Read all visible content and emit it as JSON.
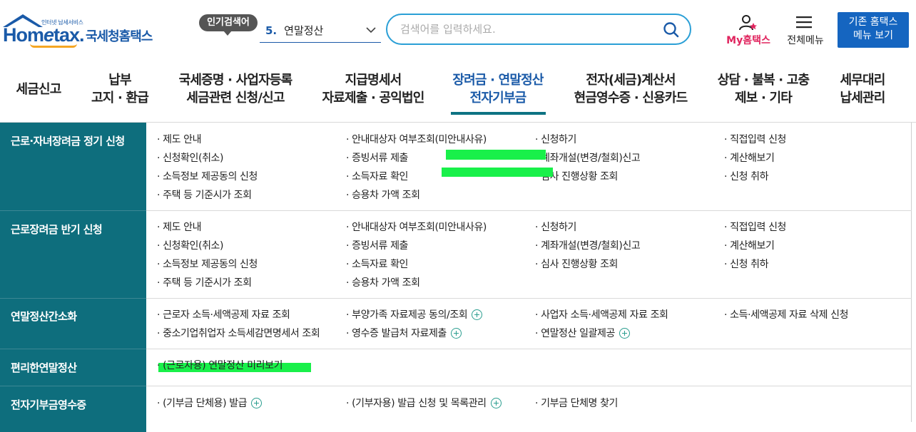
{
  "header": {
    "logo_small": "인터넷 납세서비스",
    "logo_main_pre": "Hom",
    "logo_main_e": "e",
    "logo_main_post": "tax.",
    "logo_kor": "국세청홈택스",
    "popular_badge": "인기검색어",
    "popular_rank": "5.",
    "popular_term": "연말정산",
    "search_placeholder": "검색어를 입력하세요.",
    "myhometax_label": "My홈택스",
    "allmenu_label": "전체메뉴",
    "old_hometax_line1": "기존 홈택스",
    "old_hometax_line2": "메뉴 보기"
  },
  "gnb": [
    {
      "line1": "세금신고",
      "line2": ""
    },
    {
      "line1": "납부",
      "line2": "고지 · 환급"
    },
    {
      "line1": "국세증명 · 사업자등록",
      "line2": "세금관련 신청/신고"
    },
    {
      "line1": "지급명세서",
      "line2": "자료제출 · 공익법인"
    },
    {
      "line1": "장려금 · 연말정산",
      "line2": "전자기부금"
    },
    {
      "line1": "전자(세금)계산서",
      "line2": "현금영수증 · 신용카드"
    },
    {
      "line1": "상담 · 불복 · 고충",
      "line2": "제보 · 기타"
    },
    {
      "line1": "세무대리",
      "line2": "납세관리"
    }
  ],
  "sections": [
    {
      "title": "근로·자녀장려금 정기 신청",
      "cols": [
        [
          "· 제도 안내",
          "· 신청확인(취소)",
          "· 소득정보 제공동의 신청",
          "· 주택 등 기준시가 조회"
        ],
        [
          "· 안내대상자 여부조회(미안내사유)",
          "· 증빙서류 제출",
          "· 소득자료 확인",
          "· 승용차 가액 조회"
        ],
        [
          "· 신청하기",
          "· 계좌개설(변경/철회)신고",
          "· 심사 진행상황 조회"
        ],
        [
          "· 직접입력 신청",
          "· 계산해보기",
          "· 신청 취하"
        ]
      ]
    },
    {
      "title": "근로장려금 반기 신청",
      "cols": [
        [
          "· 제도 안내",
          "· 신청확인(취소)",
          "· 소득정보 제공동의 신청",
          "· 주택 등 기준시가 조회"
        ],
        [
          "· 안내대상자 여부조회(미안내사유)",
          "· 증빙서류 제출",
          "· 소득자료 확인",
          "· 승용차 가액 조회"
        ],
        [
          "· 신청하기",
          "· 계좌개설(변경/철회)신고",
          "· 심사 진행상황 조회"
        ],
        [
          "· 직접입력 신청",
          "· 계산해보기",
          "· 신청 취하"
        ]
      ]
    },
    {
      "title": "연말정산간소화",
      "cols": [
        [
          "· 근로자 소득·세액공제 자료 조회",
          "· 중소기업취업자 소득세감면명세서 조회"
        ],
        [
          "· 부양가족 자료제공 동의/조회",
          "· 영수증 발급처 자료제출"
        ],
        [
          "· 사업자 소득·세액공제 자료 조회",
          "· 연말정산 일괄제공"
        ],
        [
          "· 소득·세액공제 자료 삭제 신청"
        ]
      ]
    },
    {
      "title": "편리한연말정산",
      "cols": [
        [
          "· (근로자용) 연말정산 미리보기"
        ],
        [],
        [],
        []
      ]
    },
    {
      "title": "전자기부금영수증",
      "cols": [
        [
          "· (기부금 단체용) 발급"
        ],
        [
          "· (기부자용) 발급 신청 및 목록관리"
        ],
        [
          "· 기부금 단체명 찾기"
        ],
        []
      ]
    }
  ]
}
